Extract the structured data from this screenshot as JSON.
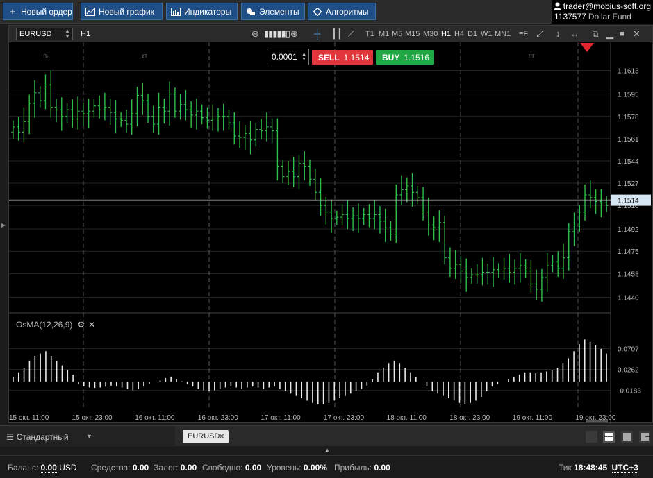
{
  "toolbar": {
    "new_order": "Новый ордер",
    "new_chart": "Новый график",
    "indicators": "Индикаторы",
    "elements": "Элементы",
    "algorithms": "Алгоритмы"
  },
  "user": {
    "email": "trader@mobius-soft.org",
    "account": "1137577",
    "fund": "Dollar Fund"
  },
  "chart": {
    "symbol": "EURUSD",
    "timeframe": "H1",
    "timeframes": [
      "T1",
      "M1",
      "M5",
      "M15",
      "M30",
      "H1",
      "H4",
      "D1",
      "W1",
      "MN1"
    ],
    "active_timeframe": "H1",
    "price_step": "0.0001",
    "sell_label": "SELL",
    "sell_price": "1.1514",
    "buy_label": "BUY",
    "buy_price": "1.1516",
    "current_price": "1.1514",
    "day_labels": [
      "пн",
      "вт",
      "пт"
    ],
    "osma_label": "OsMA(12,26,9)"
  },
  "chart_data": {
    "type": "candlestick",
    "price_axis_ticks": [
      1.1613,
      1.1595,
      1.1578,
      1.1561,
      1.1544,
      1.1527,
      1.151,
      1.1492,
      1.1475,
      1.1458,
      1.144
    ],
    "price_range": [
      1.1428,
      1.1625
    ],
    "current_line": 1.1514,
    "osma_ticks": [
      0.0707,
      0.0262,
      -0.0183
    ],
    "osma_range": [
      -0.06,
      0.12
    ],
    "time_labels": [
      "15 окт. 11:00",
      "15 окт. 23:00",
      "16 окт. 11:00",
      "16 окт. 23:00",
      "17 окт. 11:00",
      "17 окт. 23:00",
      "18 окт. 11:00",
      "18 окт. 23:00",
      "19 окт. 11:00",
      "19 окт. 23:00"
    ],
    "series": [
      {
        "name": "EURUSD H1",
        "close": [
          1.157,
          1.1566,
          1.1574,
          1.1588,
          1.1596,
          1.159,
          1.1602,
          1.1585,
          1.1583,
          1.1578,
          1.1583,
          1.1576,
          1.1582,
          1.158,
          1.1582,
          1.1586,
          1.1583,
          1.1585,
          1.1581,
          1.1576,
          1.1575,
          1.1572,
          1.158,
          1.1594,
          1.159,
          1.1578,
          1.1572,
          1.1585,
          1.1582,
          1.1595,
          1.1582,
          1.1587,
          1.1583,
          1.1579,
          1.1582,
          1.1577,
          1.1575,
          1.1576,
          1.1578,
          1.1578,
          1.1573,
          1.1563,
          1.1562,
          1.1565,
          1.156,
          1.1568,
          1.1567,
          1.157,
          1.1567,
          1.154,
          1.1532,
          1.1536,
          1.1532,
          1.1542,
          1.154,
          1.153,
          1.152,
          1.151,
          1.1505,
          1.15,
          1.1501,
          1.1503,
          1.15,
          1.1502,
          1.15,
          1.1503,
          1.15,
          1.1503,
          1.1498,
          1.1493,
          1.1488,
          1.1518,
          1.1522,
          1.1525,
          1.152,
          1.1516,
          1.1505,
          1.1495,
          1.1493,
          1.1497,
          1.147,
          1.1462,
          1.1465,
          1.146,
          1.1455,
          1.1457,
          1.1457,
          1.1459,
          1.1459,
          1.1461,
          1.146,
          1.1462,
          1.1459,
          1.1462,
          1.1464,
          1.146,
          1.145,
          1.1446,
          1.1455,
          1.1464,
          1.1467,
          1.1462,
          1.147,
          1.149,
          1.1495,
          1.1505,
          1.1518,
          1.1516,
          1.1513,
          1.1512,
          1.151
        ]
      },
      {
        "name": "OsMA",
        "values": [
          0.01,
          0.02,
          0.03,
          0.045,
          0.055,
          0.06,
          0.065,
          0.055,
          0.045,
          0.035,
          0.025,
          0.015,
          -0.005,
          -0.01,
          -0.012,
          -0.013,
          -0.012,
          -0.01,
          -0.008,
          -0.01,
          -0.012,
          -0.015,
          -0.018,
          -0.015,
          -0.01,
          -0.005,
          0.0,
          0.003,
          0.008,
          0.01,
          0.006,
          0.001,
          -0.005,
          -0.01,
          -0.015,
          -0.018,
          -0.02,
          -0.018,
          -0.015,
          -0.012,
          -0.01,
          -0.012,
          -0.015,
          -0.012,
          -0.01,
          -0.012,
          -0.015,
          -0.012,
          -0.01,
          -0.015,
          -0.02,
          -0.025,
          -0.03,
          -0.035,
          -0.04,
          -0.045,
          -0.048,
          -0.048,
          -0.045,
          -0.04,
          -0.035,
          -0.03,
          -0.025,
          -0.02,
          -0.015,
          -0.008,
          0.005,
          0.02,
          0.03,
          0.04,
          0.045,
          0.04,
          0.03,
          0.02,
          0.01,
          0.0,
          -0.01,
          -0.02,
          -0.025,
          -0.03,
          -0.035,
          -0.04,
          -0.045,
          -0.048,
          -0.045,
          -0.04,
          -0.032,
          -0.02,
          -0.01,
          -0.005,
          0.0,
          0.005,
          0.01,
          0.015,
          0.02,
          0.02,
          0.018,
          0.02,
          0.022,
          0.025,
          0.03,
          0.04,
          0.05,
          0.065,
          0.08,
          0.09,
          0.085,
          0.078,
          0.07,
          0.06
        ]
      }
    ]
  },
  "tabs": {
    "workspace": "Стандартный",
    "doc_tab": "EURUSD"
  },
  "status": {
    "balance_label": "Баланс:",
    "balance_value": "0.00",
    "balance_currency": "USD",
    "funds_label": "Средства:",
    "funds_value": "0.00",
    "margin_label": "Залог:",
    "margin_value": "0.00",
    "free_label": "Свободно:",
    "free_value": "0.00",
    "level_label": "Уровень:",
    "level_value": "0.00%",
    "profit_label": "Прибыль:",
    "profit_value": "0.00",
    "tick_label": "Тик",
    "tick_time": "18:48:45",
    "timezone": "UTC+3"
  },
  "colors": {
    "candle": "#2fbf4a",
    "osma_bar": "#e8e8e8",
    "sell": "#e0363c",
    "buy": "#22a745",
    "accent": "#1f4f86",
    "alert_marker": "#e0262c"
  }
}
